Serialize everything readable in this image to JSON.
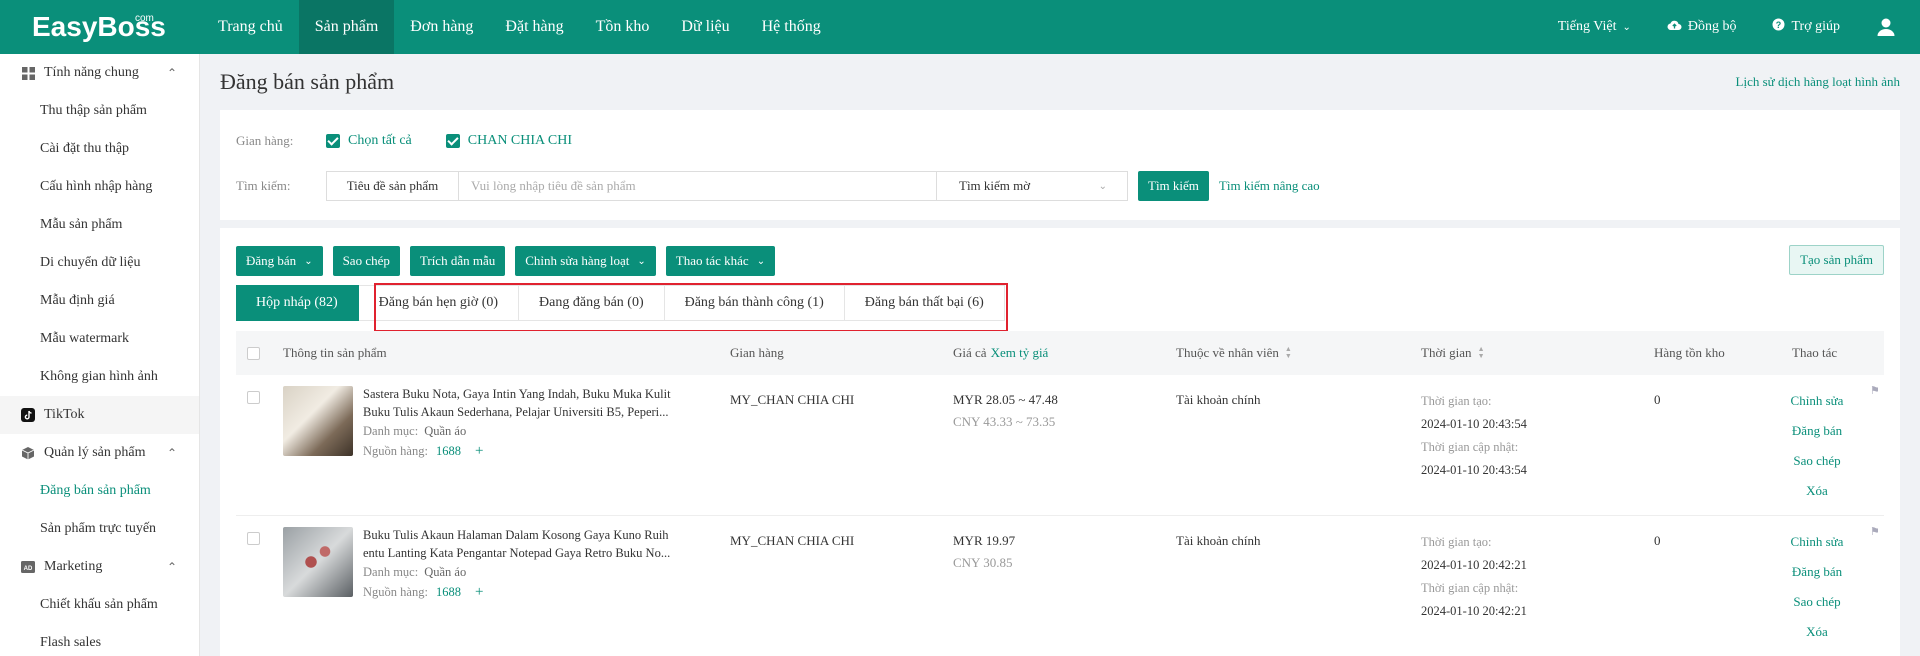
{
  "app": {
    "logo": "EasyBoss",
    "logo_sup": "com"
  },
  "nav": [
    "Trang chủ",
    "Sản phẩm",
    "Đơn hàng",
    "Đặt hàng",
    "Tồn kho",
    "Dữ liệu",
    "Hệ thống"
  ],
  "top_right": {
    "language": "Tiếng Việt",
    "sync": "Đồng bộ",
    "help": "Trợ giúp"
  },
  "sidebar": {
    "general": "Tính năng chung",
    "general_items": [
      "Thu thập sản phẩm",
      "Cài đặt thu thập",
      "Cấu hình nhập hàng",
      "Mẫu sản phẩm",
      "Di chuyển dữ liệu",
      "Mẫu định giá",
      "Mẫu watermark",
      "Không gian hình ảnh"
    ],
    "tiktok": "TikTok",
    "product_mgmt": "Quản lý sản phẩm",
    "product_items": [
      "Đăng bán sản phẩm",
      "Sản phẩm trực tuyến"
    ],
    "marketing": "Marketing",
    "marketing_items": [
      "Chiết khấu sản phẩm",
      "Flash sales"
    ]
  },
  "page": {
    "title": "Đăng bán sản phẩm",
    "history_link": "Lịch sử dịch hàng loạt hình ảnh"
  },
  "filter": {
    "store_label": "Gian hàng:",
    "select_all": "Chọn tất cả",
    "store_name": "CHAN CHIA CHI",
    "search_label": "Tìm kiếm:",
    "search_field": "Tiêu đề sản phẩm",
    "search_placeholder": "Vui lòng nhập tiêu đề sản phẩm",
    "match_mode": "Tìm kiếm mờ",
    "search_button": "Tìm kiếm",
    "advanced": "Tìm kiếm nâng cao"
  },
  "toolbar": {
    "publish": "Đăng bán",
    "copy": "Sao chép",
    "extract": "Trích dẫn mẫu",
    "batch_edit": "Chỉnh sửa hàng loạt",
    "other": "Thao tác khác",
    "create": "Tạo sản phẩm"
  },
  "tabs": [
    "Hộp nháp (82)",
    "Đăng bán hẹn giờ (0)",
    "Đang đăng bán (0)",
    "Đăng bán thành công (1)",
    "Đăng bán thất bại (6)"
  ],
  "table": {
    "headers": {
      "product": "Thông tin sản phẩm",
      "store": "Gian hàng",
      "price": "Giá cả",
      "price_link": "Xem tỷ giá",
      "staff": "Thuộc về nhân viên",
      "time": "Thời gian",
      "stock": "Hàng tồn kho",
      "actions": "Thao tác"
    },
    "category_label": "Danh mục:",
    "source_label": "Nguồn hàng:",
    "created_label": "Thời gian tạo:",
    "updated_label": "Thời gian cập nhật:",
    "action_labels": [
      "Chỉnh sửa",
      "Đăng bán",
      "Sao chép",
      "Xóa"
    ],
    "rows": [
      {
        "title_line1": "Sastera Buku Nota, Gaya Intin Yang Indah, Buku Muka Kulit",
        "title_line2": "Buku Tulis Akaun Sederhana, Pelajar Universiti B5, Peperi...",
        "category": "Quần áo",
        "source": "1688",
        "store": "MY_CHAN CHIA CHI",
        "price_myr": "MYR 28.05 ~ 47.48",
        "price_cny": "CNY 43.33 ~ 73.35",
        "staff": "Tài khoản chính",
        "created": "2024-01-10 20:43:54",
        "updated": "2024-01-10 20:43:54",
        "stock": "0"
      },
      {
        "title_line1": "Buku Tulis Akaun Halaman Dalam Kosong Gaya Kuno Ruih",
        "title_line2": "entu Lanting Kata Pengantar Notepad Gaya Retro Buku No...",
        "category": "Quần áo",
        "source": "1688",
        "store": "MY_CHAN CHIA CHI",
        "price_myr": "MYR 19.97",
        "price_cny": "CNY 30.85",
        "staff": "Tài khoản chính",
        "created": "2024-01-10 20:42:21",
        "updated": "2024-01-10 20:42:21",
        "stock": "0"
      }
    ]
  }
}
